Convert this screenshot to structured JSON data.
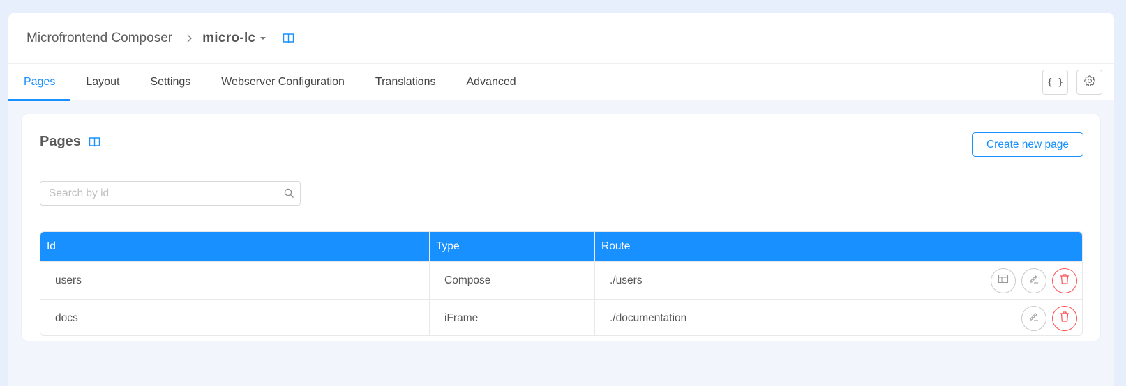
{
  "header": {
    "app_title": "Microfrontend Composer",
    "breadcrumb_separator_icon": "chevron-right-icon",
    "project_name": "micro-lc",
    "project_dropdown_icon": "caret-down-icon",
    "docs_icon": "book-icon"
  },
  "tabs": [
    {
      "label": "Pages",
      "active": true
    },
    {
      "label": "Layout",
      "active": false
    },
    {
      "label": "Settings",
      "active": false
    },
    {
      "label": "Webserver Configuration",
      "active": false
    },
    {
      "label": "Translations",
      "active": false
    },
    {
      "label": "Advanced",
      "active": false
    }
  ],
  "toolbar": {
    "json_button_label": "{ }",
    "json_button_icon": "code-braces-icon",
    "settings_button_icon": "gear-icon"
  },
  "pages_card": {
    "title": "Pages",
    "docs_icon": "book-icon",
    "create_button_label": "Create new page",
    "search": {
      "placeholder": "Search by id",
      "value": "",
      "icon": "search-icon"
    },
    "table": {
      "columns": [
        "Id",
        "Type",
        "Route",
        ""
      ],
      "rows": [
        {
          "id": "users",
          "type": "Compose",
          "route": "./users",
          "actions": [
            "layout-icon",
            "edit-icon",
            "delete-icon"
          ]
        },
        {
          "id": "docs",
          "type": "iFrame",
          "route": "./documentation",
          "actions": [
            "edit-icon",
            "delete-icon"
          ]
        }
      ]
    }
  },
  "colors": {
    "accent": "#1890ff",
    "danger": "#ff4d4f",
    "page_background": "#e6effb",
    "content_background": "#f2f6fc"
  }
}
